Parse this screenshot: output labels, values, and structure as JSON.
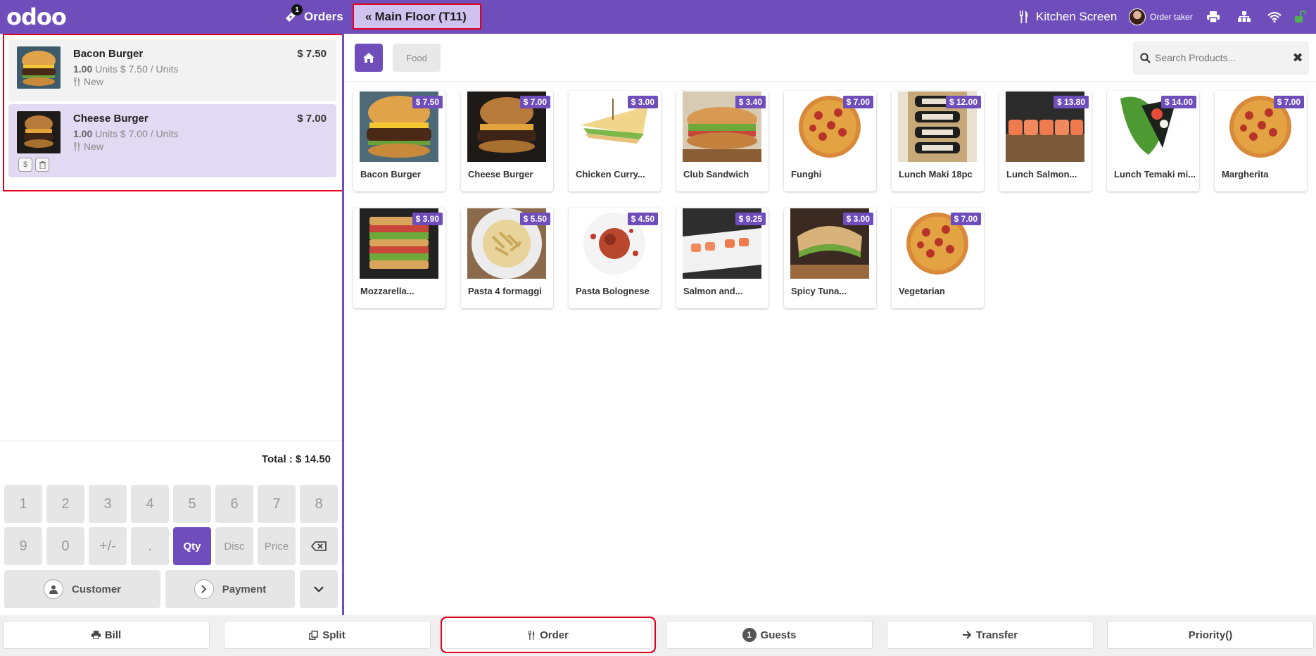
{
  "app": {
    "logo": "odoo",
    "orders_label": "Orders",
    "orders_count": "1",
    "floor_label": "Main Floor (T11)",
    "kitchen_label": "Kitchen Screen",
    "user_label": "Order taker",
    "brand_color": "#6f4ebc",
    "connection_ok_color": "#4caf50"
  },
  "order": {
    "lines": [
      {
        "name": "Bacon Burger",
        "price": "$ 7.50",
        "qty": "1.00",
        "unit_text": "Units $ 7.50 / Units",
        "status": "New",
        "selected": false
      },
      {
        "name": "Cheese Burger",
        "price": "$ 7.00",
        "qty": "1.00",
        "unit_text": "Units $ 7.00 / Units",
        "status": "New",
        "selected": true
      }
    ],
    "total": "Total : $ 14.50"
  },
  "numpad": {
    "row1": [
      "1",
      "2",
      "3",
      "4",
      "5",
      "6",
      "7",
      "8"
    ],
    "row2": [
      "9",
      "0",
      "+/-",
      ".",
      "Qty",
      "Disc",
      "Price"
    ],
    "customer_label": "Customer",
    "payment_label": "Payment"
  },
  "categories": {
    "home_icon": "home-icon",
    "food_label": "Food"
  },
  "search": {
    "placeholder": "Search Products..."
  },
  "products": [
    {
      "name": "Bacon Burger",
      "price": "$ 7.50",
      "icon": "burger"
    },
    {
      "name": "Cheese Burger",
      "price": "$ 7.00",
      "icon": "burger-dark"
    },
    {
      "name": "Chicken Curry...",
      "price": "$ 3.00",
      "icon": "sandwich-triangle"
    },
    {
      "name": "Club Sandwich",
      "price": "$ 3.40",
      "icon": "sub-sandwich"
    },
    {
      "name": "Funghi",
      "price": "$ 7.00",
      "icon": "pizza"
    },
    {
      "name": "Lunch Maki 18pc",
      "price": "$ 12.00",
      "icon": "maki"
    },
    {
      "name": "Lunch Salmon...",
      "price": "$ 13.80",
      "icon": "sushi"
    },
    {
      "name": "Lunch Temaki mi...",
      "price": "$ 14.00",
      "icon": "temaki"
    },
    {
      "name": "Margherita",
      "price": "$ 7.00",
      "icon": "pizza"
    },
    {
      "name": "Mozzarella...",
      "price": "$ 3.90",
      "icon": "club-stack"
    },
    {
      "name": "Pasta 4 formaggi",
      "price": "$ 5.50",
      "icon": "pasta"
    },
    {
      "name": "Pasta Bolognese",
      "price": "$ 4.50",
      "icon": "pasta-red"
    },
    {
      "name": "Salmon and...",
      "price": "$ 9.25",
      "icon": "salmon-plate"
    },
    {
      "name": "Spicy Tuna...",
      "price": "$ 3.00",
      "icon": "panini"
    },
    {
      "name": "Vegetarian",
      "price": "$ 7.00",
      "icon": "pizza"
    }
  ],
  "actions": {
    "bill": "Bill",
    "split": "Split",
    "order": "Order",
    "guests_count": "1",
    "guests": "Guests",
    "transfer": "Transfer",
    "priority": "Priority()"
  }
}
